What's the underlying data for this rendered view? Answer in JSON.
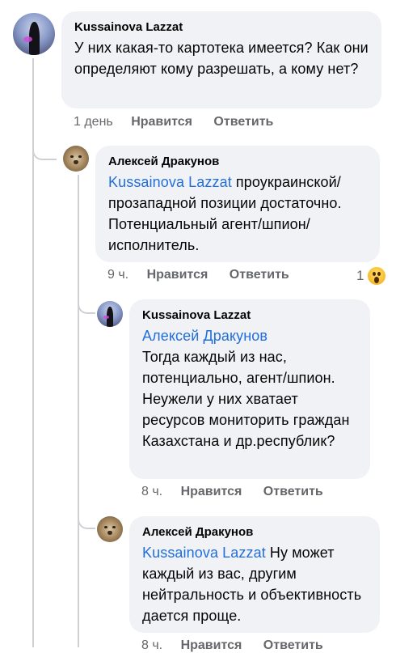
{
  "comments": [
    {
      "author": "Kussainova Lazzat",
      "mention": "",
      "text": "У них какая-то картотека имеется? Как они определяют кому разрешать, а кому нет?",
      "time": "1 день",
      "like": "Нравится",
      "reply": "Ответить"
    },
    {
      "author": "Алексей Дракунов",
      "mention": "Kussainova Lazzat",
      "text": " проукраинской/ прозападной позиции достаточно. Потенциальный агент/шпион/исполнитель.",
      "time": "9 ч.",
      "like": "Нравится",
      "reply": "Ответить",
      "reaction_count": "1",
      "reaction_icon": "wow-emoji-icon"
    },
    {
      "author": "Kussainova Lazzat",
      "mention": "Алексей Дракунов",
      "text": " Тогда каждый из нас, потенциально, агент/шпион. Неужели у них хватает ресурсов мониторить граждан Казахстана и др.республик?",
      "time": "8 ч.",
      "like": "Нравится",
      "reply": "Ответить"
    },
    {
      "author": "Алексей Дракунов",
      "mention": "Kussainova Lazzat",
      "text": " Ну может каждый из вас, другим нейтральность и объективность дается проще.",
      "time": "8 ч.",
      "like": "Нравится",
      "reply": "Ответить"
    }
  ],
  "colors": {
    "bubble": "#f0f2f5",
    "mention": "#216fdb",
    "meta": "#65676b",
    "thread": "#ced0d4"
  }
}
